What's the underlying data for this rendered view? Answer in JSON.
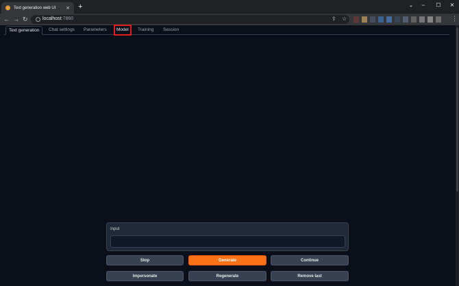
{
  "browser": {
    "tab_title": "Text generation web UI",
    "tab_close": "✕",
    "new_tab": "+",
    "url_host": "localhost",
    "url_port": ":7860",
    "icons": [
      "info-icon",
      "share-icon",
      "bookmark-star-icon"
    ],
    "window_controls": {
      "chevron": "⌄",
      "minimize": "–",
      "maximize": "☐",
      "close": "✕"
    },
    "nav": {
      "back": "←",
      "forward": "→",
      "reload": "↻"
    },
    "menu": "⋮",
    "extension_colors": [
      "#6b3a3a",
      "#b8935a",
      "#4a5568",
      "#3b6ea5",
      "#4a7ab5",
      "#3a4660",
      "#5b6b80",
      "#6a6a6a",
      "#8a8a8a",
      "#9a9a9a",
      "#7a7a7a"
    ]
  },
  "app": {
    "tabs": [
      {
        "label": "Text generation",
        "active": true
      },
      {
        "label": "Chat settings"
      },
      {
        "label": "Parameters"
      },
      {
        "label": "Model",
        "highlighted": true
      },
      {
        "label": "Training"
      },
      {
        "label": "Session"
      }
    ],
    "input": {
      "label": "Input",
      "value": ""
    },
    "buttons": {
      "stop": "Stop",
      "generate": "Generate",
      "continue": "Continue",
      "impersonate": "Impersonate",
      "regenerate": "Regenerate",
      "remove_last": "Remove last"
    },
    "colors": {
      "accent": "#f97316",
      "highlight_box": "#e11d1d",
      "background": "#0b0f19"
    }
  }
}
